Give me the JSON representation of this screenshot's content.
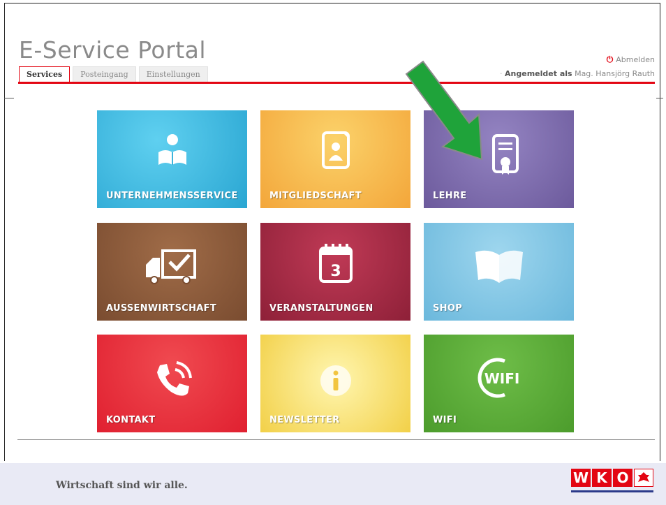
{
  "header": {
    "title": "E-Service Portal",
    "tabs": [
      {
        "label": "Services",
        "active": true
      },
      {
        "label": "Posteingang",
        "active": false
      },
      {
        "label": "Einstellungen",
        "active": false
      }
    ],
    "logout_label": "Abmelden",
    "login_prefix": "Angemeldet als",
    "login_user": "Mag. Hansjörg Rauth"
  },
  "tiles": [
    {
      "label": "UNTERNEHMENSSERVICE",
      "icon": "reader-icon",
      "color": "#3cb4dc"
    },
    {
      "label": "MITGLIEDSCHAFT",
      "icon": "member-card-icon",
      "color": "#f7b54a"
    },
    {
      "label": "LEHRE",
      "icon": "certificate-icon",
      "color": "#7a67a8"
    },
    {
      "label": "AUSSENWIRTSCHAFT",
      "icon": "truck-icon",
      "color": "#8a5a3a"
    },
    {
      "label": "VERANSTALTUNGEN",
      "icon": "calendar-icon",
      "color": "#a82a44"
    },
    {
      "label": "SHOP",
      "icon": "book-icon",
      "color": "#7ec4e0"
    },
    {
      "label": "KONTAKT",
      "icon": "phone-icon",
      "color": "#e8303a"
    },
    {
      "label": "NEWSLETTER",
      "icon": "info-icon",
      "color": "#f5d850"
    },
    {
      "label": "WIFI",
      "icon": "wifi-logo-icon",
      "color": "#5aab36"
    }
  ],
  "calendar_day": "3",
  "wifi_text": "WIFI",
  "footer": {
    "slogan": "Wirtschaft sind wir alle.",
    "logo_letters": [
      "W",
      "K",
      "O"
    ]
  }
}
